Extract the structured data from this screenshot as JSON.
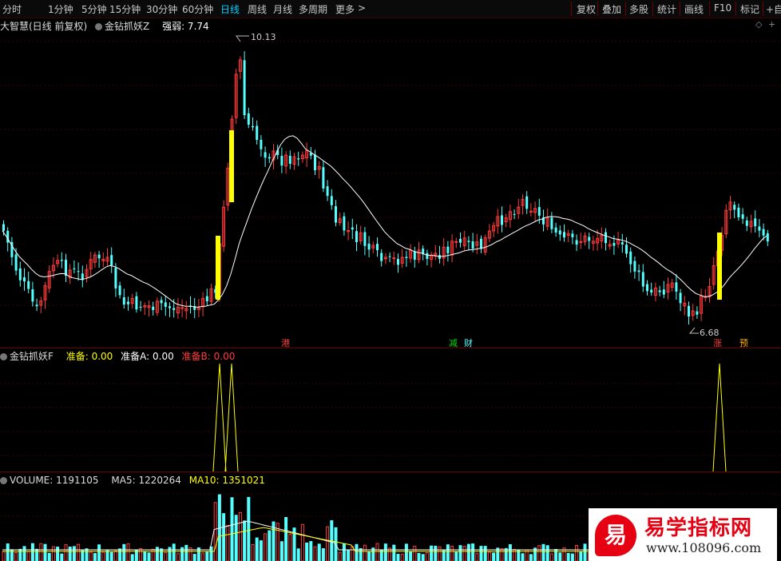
{
  "toolbar": {
    "periods": [
      "分时",
      "1分钟",
      "5分钟",
      "15分钟",
      "30分钟",
      "60分钟",
      "日线",
      "周线",
      "月线",
      "多周期",
      "更多"
    ],
    "active": "日线",
    "right": [
      "复权",
      "叠加",
      "多股",
      "统计",
      "画线",
      "F10",
      "标记",
      "+自"
    ]
  },
  "main": {
    "stock": "大智慧(日线 前复权)",
    "indicator": "金钻抓妖Z",
    "strength_label": "强弱: 7.74",
    "high_label": "10.13",
    "low_label": "6.68",
    "signals": [
      "港",
      "减",
      "财",
      "涨",
      "预"
    ]
  },
  "sub": {
    "indicator": "金钻抓妖F",
    "ready": "准备: 0.00",
    "ready_a": "准备A: 0.00",
    "ready_b": "准备B: 0.00"
  },
  "volume": {
    "label": "VOLUME: 1191105",
    "ma5": "MA5: 1220264",
    "ma10": "MA10: 1351021"
  },
  "watermark": {
    "mark": "易",
    "title": "易学指标网",
    "url": "www.108096.com"
  },
  "colors": {
    "up": "#ff3b3b",
    "down": "#54ffff",
    "ma": "#ffffff",
    "signal": "#ffff00",
    "grid": "#6a0000"
  }
}
